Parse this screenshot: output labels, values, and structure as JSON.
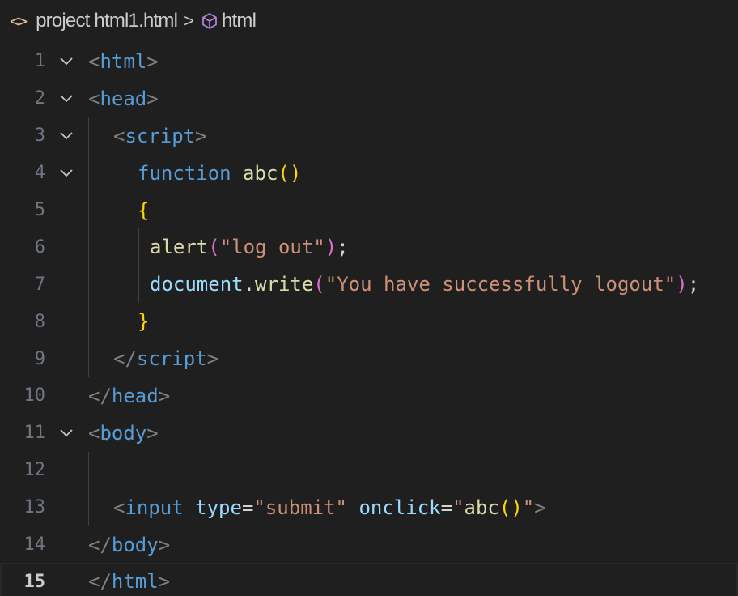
{
  "breadcrumb": {
    "folder": "project",
    "file": "html1.html",
    "separator": ">",
    "symbol": "html",
    "file_icon": "<>"
  },
  "lines": [
    {
      "number": "1"
    },
    {
      "number": "2"
    },
    {
      "number": "3"
    },
    {
      "number": "4"
    },
    {
      "number": "5"
    },
    {
      "number": "6"
    },
    {
      "number": "7"
    },
    {
      "number": "8"
    },
    {
      "number": "9"
    },
    {
      "number": "10"
    },
    {
      "number": "11"
    },
    {
      "number": "12"
    },
    {
      "number": "13"
    },
    {
      "number": "14"
    },
    {
      "number": "15"
    }
  ],
  "tokens": {
    "l1": [
      "<",
      "html",
      ">"
    ],
    "l2": [
      "<",
      "head",
      ">"
    ],
    "l3": [
      "<",
      "script",
      ">"
    ],
    "l4": [
      "function",
      " ",
      "abc",
      "(",
      ")"
    ],
    "l5": [
      "{"
    ],
    "l6": [
      "alert",
      "(",
      "\"log out\"",
      ")",
      ";"
    ],
    "l7": [
      "document",
      ".",
      "write",
      "(",
      "\"You have successfully logout\"",
      ")",
      ";"
    ],
    "l8": [
      "}"
    ],
    "l9": [
      "</",
      "script",
      ">"
    ],
    "l10": [
      "</",
      "head",
      ">"
    ],
    "l11": [
      "<",
      "body",
      ">"
    ],
    "l13": [
      "<",
      "input",
      " ",
      "type",
      "=",
      "\"submit\"",
      " ",
      "onclick",
      "=",
      "\"",
      "abc",
      "(",
      ")",
      "\"",
      ">"
    ],
    "l14": [
      "</",
      "body",
      ">"
    ],
    "l15": [
      "</",
      "html",
      ">"
    ]
  },
  "colors": {
    "background": "#1f1f1f",
    "tag": "#569cd6",
    "punctuation": "#808080",
    "string": "#ce9178",
    "attribute": "#9cdcfe",
    "function": "#dcdcaa",
    "bracket_gold": "#ffd700",
    "line_number": "#6e7681"
  },
  "icons": {
    "fold": "chevron-down-icon",
    "file": "html-file-icon",
    "symbol": "cube-icon"
  }
}
